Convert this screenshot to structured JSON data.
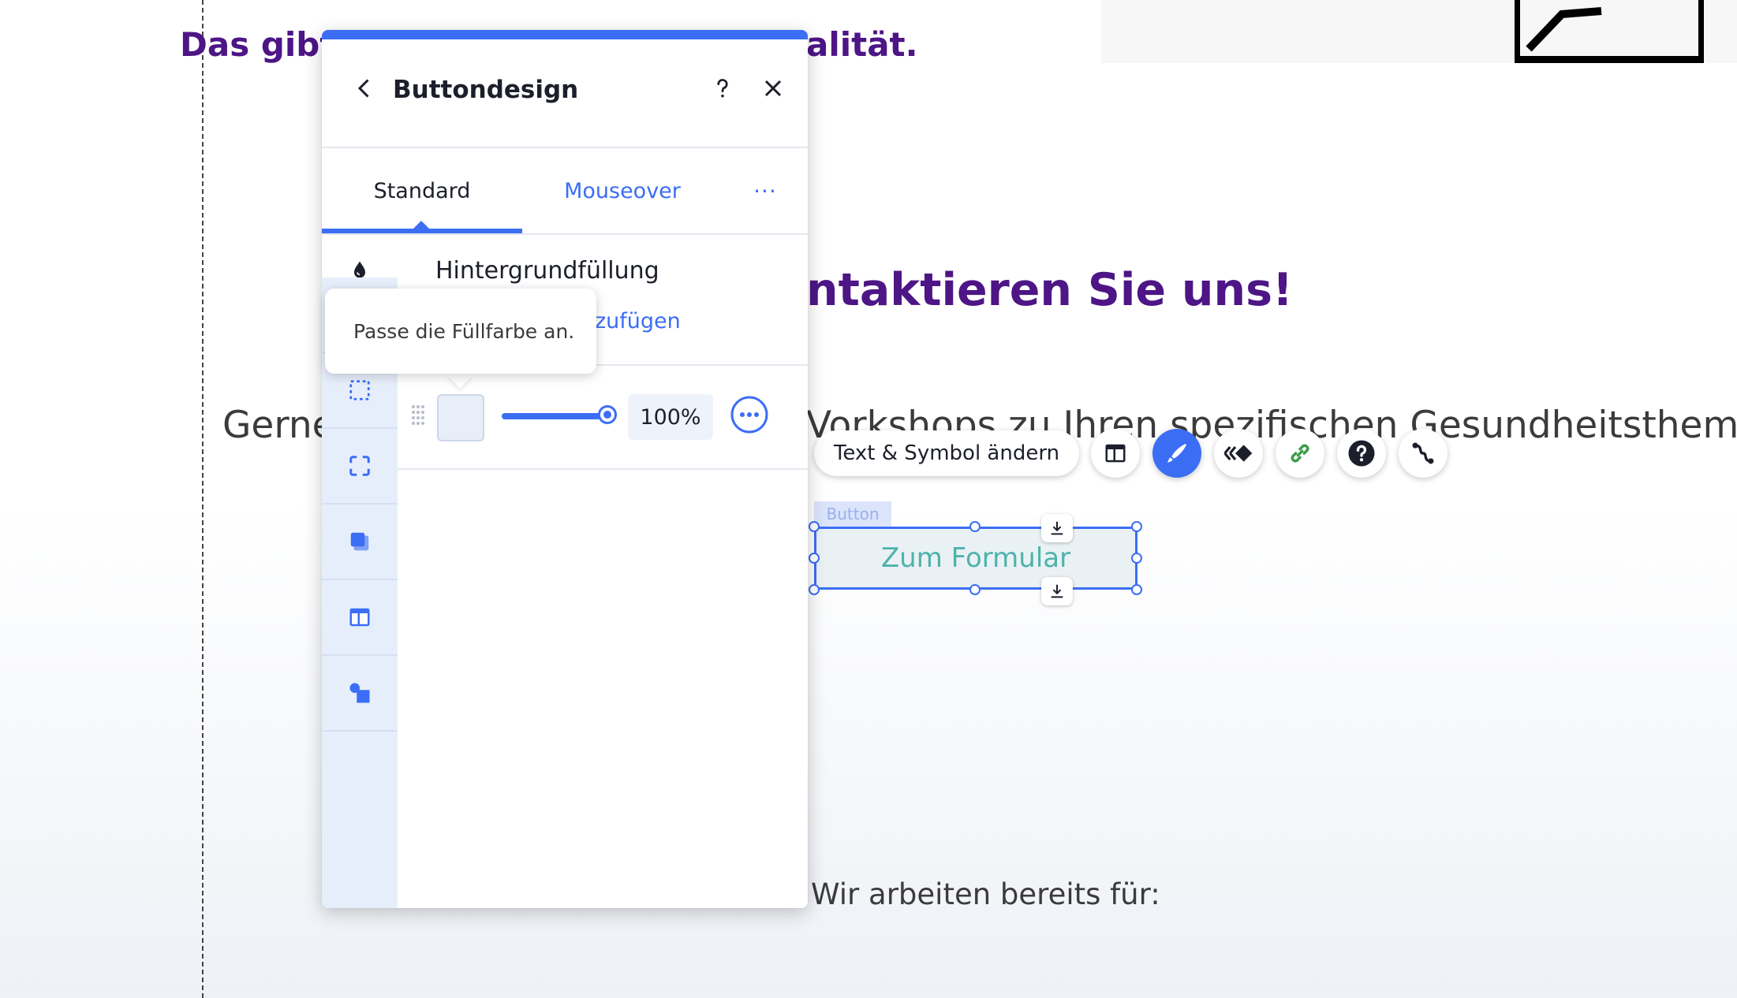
{
  "page": {
    "headline_top_left": "Das gibt",
    "headline_top_right": "alität.",
    "contact_heading": "ntaktieren Sie uns!",
    "body_left": "Gerne",
    "body_right": "Vorkshops zu Ihren spezifischen Gesundheitsthemen.",
    "bottom_text": "Wir arbeiten bereits für:"
  },
  "panel": {
    "title": "Buttondesign",
    "tabs": [
      {
        "label": "Standard",
        "active": true
      },
      {
        "label": "Mouseover",
        "active": false
      },
      {
        "label": "···",
        "active": false
      }
    ],
    "fill_section_label": "Hintergrundfüllung",
    "add_link": "zufügen",
    "opacity_value": "100%",
    "tooltip": "Passe die Füllfarbe an.",
    "sidebar_icons": [
      "fill-icon",
      "border-icon",
      "corners-icon",
      "shadow-icon",
      "layout-icon",
      "text-icon"
    ]
  },
  "toolbar": {
    "change_text_symbol": "Text & Symbol ändern",
    "icons": [
      "layout-icon",
      "design-brush-icon",
      "animation-icon",
      "link-icon",
      "help-icon",
      "connect-icon"
    ]
  },
  "selected_element": {
    "tag": "Button",
    "label": "Zum Formular"
  },
  "colors": {
    "accent": "#3b6ef5",
    "headline": "#4d1585",
    "button_text": "#4db3ac",
    "link_green": "#3a9d4a"
  }
}
